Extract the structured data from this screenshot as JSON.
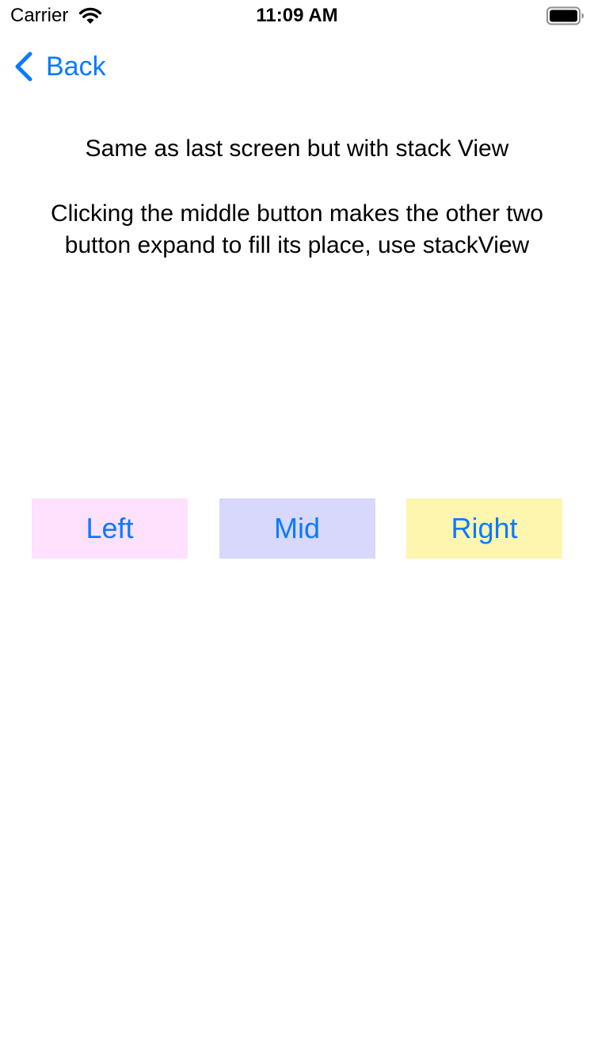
{
  "status_bar": {
    "carrier": "Carrier",
    "time": "11:09 AM",
    "icons": [
      "wifi-icon",
      "battery-icon"
    ]
  },
  "nav": {
    "back_label": "Back",
    "back_icon": "chevron-left-icon",
    "accent_color": "#0A7AFF"
  },
  "description": {
    "line1": "Same as last screen but with stack View",
    "line2": "Clicking the middle button makes the other two button expand to fill its place, use stackView"
  },
  "stack_buttons": [
    {
      "label": "Left",
      "background": "#FFE0FD"
    },
    {
      "label": "Mid",
      "background": "#D7D8FC"
    },
    {
      "label": "Right",
      "background": "#FEF5AF"
    }
  ]
}
